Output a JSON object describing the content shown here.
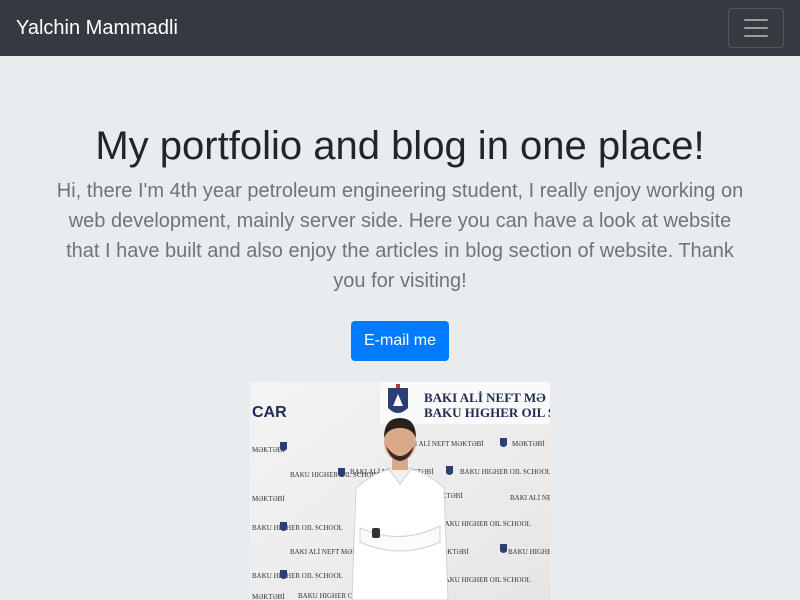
{
  "navbar": {
    "brand": "Yalchin Mammadli",
    "toggler_icon": "hamburger-menu-icon"
  },
  "hero": {
    "title": "My portfolio and blog in one place!",
    "lead": "Hi, there I'm 4th year petroleum engineering student, I really enjoy working on web development, mainly server side. Here you can have a look at website that I have built and also enjoy the articles in blog section of website. Thank you for visiting!",
    "button_label": "E-mail me"
  },
  "photo": {
    "banner_line1": "BAKI ALİ NEFT MƏ",
    "banner_line2": "BAKU HIGHER OIL S",
    "left_text": "CAR",
    "pattern_a": "BAKU HIGHER OIL SCHOOL",
    "pattern_b": "BAKI ALİ NEFT MƏKTƏBİ",
    "pattern_c": "MƏKTƏBİ"
  },
  "colors": {
    "navbar_bg": "#343a40",
    "jumbotron_bg": "#e9ecef",
    "primary": "#007bff",
    "muted_text": "#6c757d"
  }
}
